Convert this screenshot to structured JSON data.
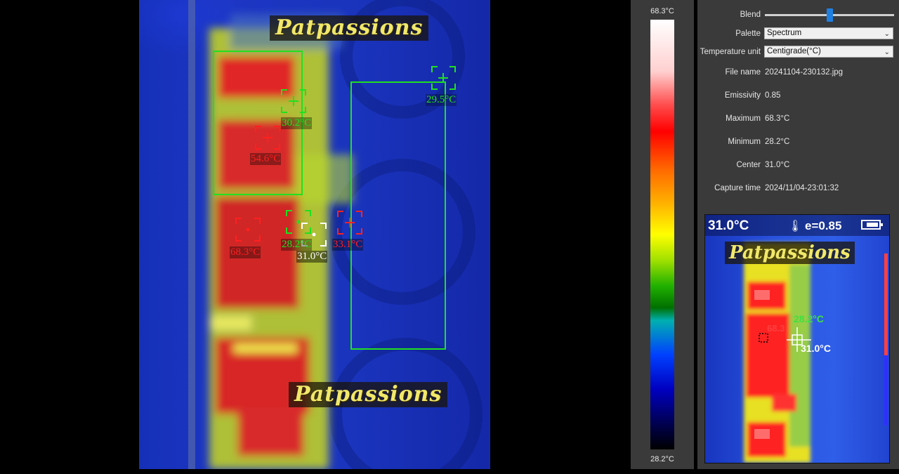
{
  "watermark": "Patpassions",
  "thermal_markers": [
    {
      "name": "marker-max",
      "value": "68.3°C",
      "color": "#ff2020"
    },
    {
      "name": "marker-hot-2",
      "value": "54.6°C",
      "color": "#ff2020"
    },
    {
      "name": "marker-hot-3",
      "value": "33.1°C",
      "color": "#ff2020"
    },
    {
      "name": "marker-cool-1",
      "value": "30.2°C",
      "color": "#20e020"
    },
    {
      "name": "marker-cool-2",
      "value": "29.5°C",
      "color": "#20e020"
    },
    {
      "name": "marker-min",
      "value": "28.2°C",
      "color": "#20e020"
    },
    {
      "name": "marker-center",
      "value": "31.0°C",
      "color": "#ffffff"
    }
  ],
  "scale": {
    "max": "68.3°C",
    "min": "28.2°C"
  },
  "controls": {
    "blend_label": "Blend",
    "blend_level": 0.5,
    "palette_label": "Palette",
    "palette_value": "Spectrum",
    "unit_label": "Temperature unit",
    "unit_value": "Centigrade(°C)"
  },
  "info": {
    "file_name_label": "File name",
    "file_name": "20241104-230132.jpg",
    "emissivity_label": "Emissivity",
    "emissivity": "0.85",
    "maximum_label": "Maximum",
    "maximum": "68.3°C",
    "minimum_label": "Minimum",
    "minimum": "28.2°C",
    "center_label": "Center",
    "center": "31.0°C",
    "capture_label": "Capture time",
    "capture_time": "2024/11/04-23:01:32"
  },
  "thumbnail": {
    "temperature": "31.0°C",
    "emissivity": "e=0.85",
    "label_min": "28.2°C",
    "label_max": "68.3",
    "label_center": "31.0°C"
  },
  "colors": {
    "hot": "#ff2020",
    "cool": "#20e020",
    "center": "#ffffff",
    "accent": "#1f7fe0"
  }
}
